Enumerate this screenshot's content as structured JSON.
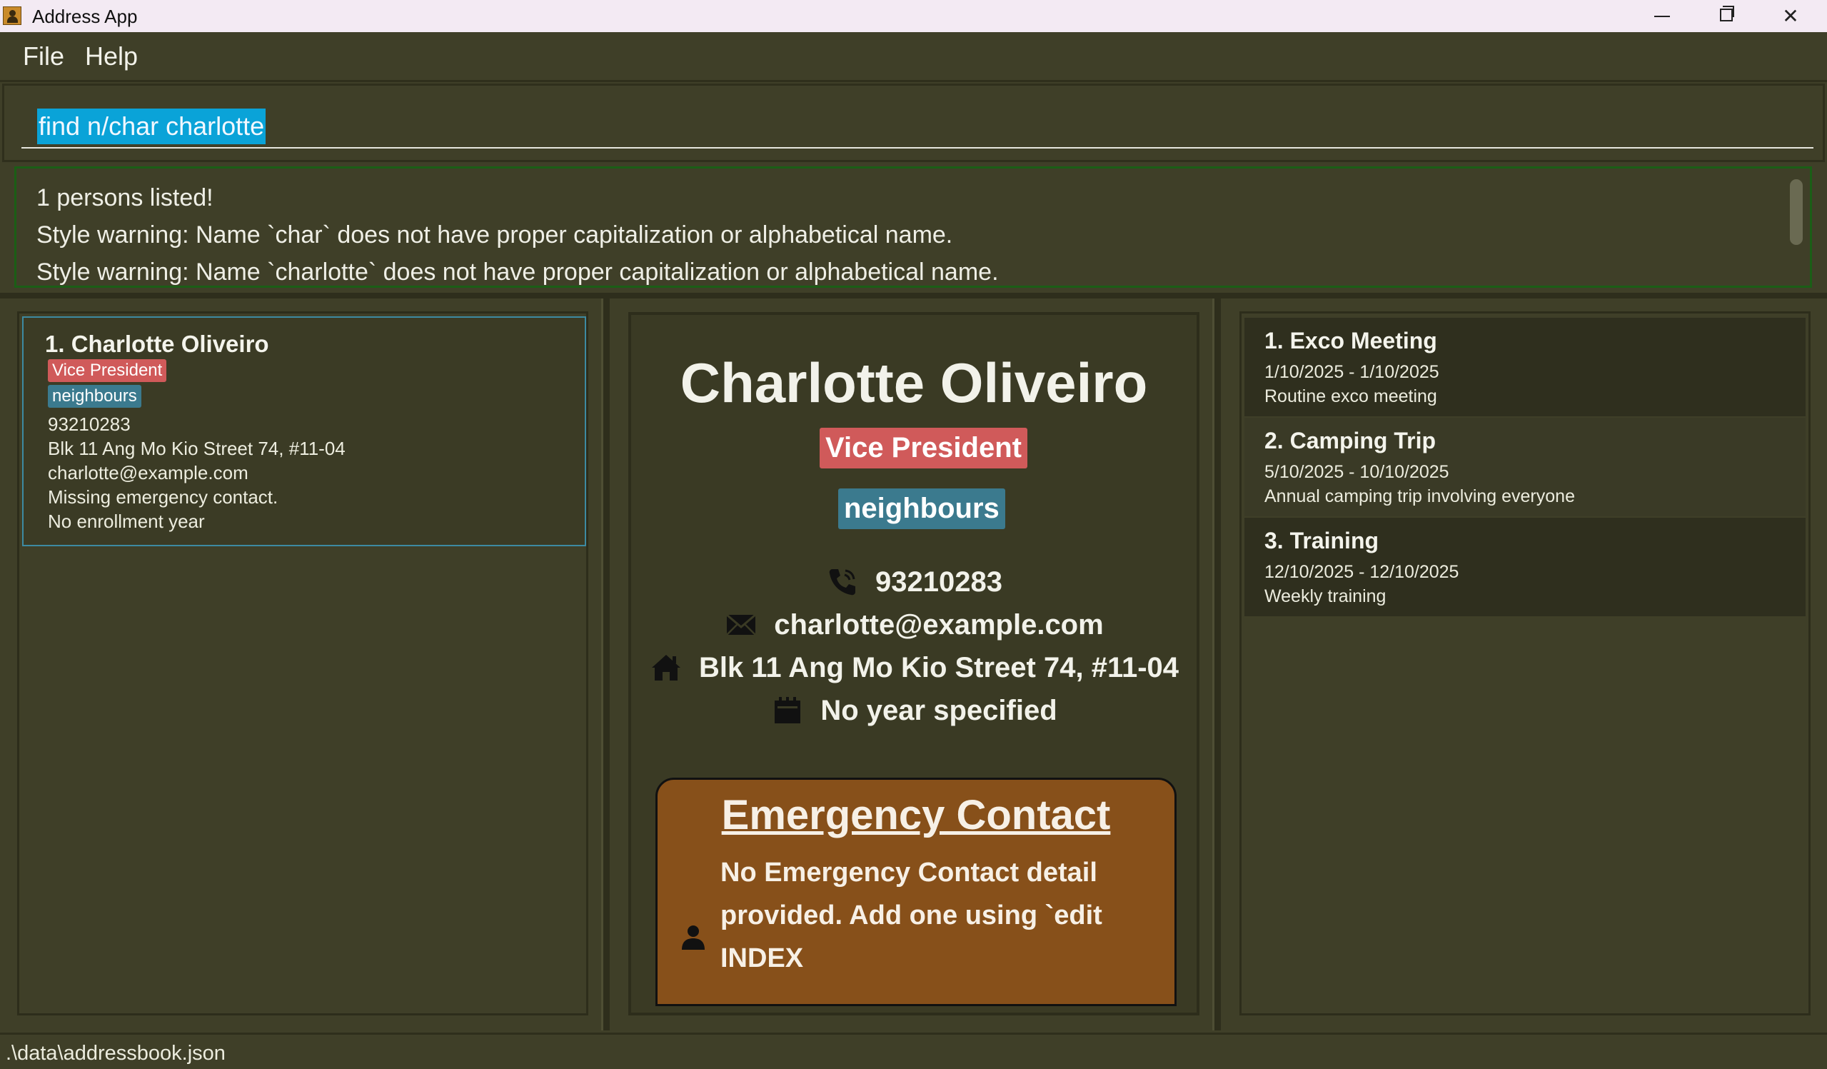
{
  "window": {
    "title": "Address App"
  },
  "menu": {
    "file": "File",
    "help": "Help"
  },
  "command": {
    "value": "find n/char charlotte"
  },
  "result": {
    "lines": [
      "1 persons listed!",
      "Style warning: Name `char` does not have proper capitalization or alphabetical name.",
      "Style warning: Name `charlotte` does not have proper capitalization or alphabetical name."
    ]
  },
  "person_list": [
    {
      "index_name": "1. Charlotte Oliveiro",
      "tags": [
        "Vice President",
        "neighbours"
      ],
      "phone": "93210283",
      "address": "Blk 11 Ang Mo Kio Street 74, #11-04",
      "email": "charlotte@example.com",
      "emergency": "Missing emergency contact.",
      "year": "No enrollment year"
    }
  ],
  "details": {
    "name": "Charlotte Oliveiro",
    "tags": [
      "Vice President",
      "neighbours"
    ],
    "phone": "93210283",
    "email": "charlotte@example.com",
    "address": "Blk 11 Ang Mo Kio Street 74, #11-04",
    "year": "No year specified",
    "emergency_title": "Emergency Contact",
    "emergency_text": "No Emergency Contact detail provided. Add one using `edit INDEX"
  },
  "events": [
    {
      "title": "1. Exco Meeting",
      "date": "1/10/2025 - 1/10/2025",
      "desc": "Routine exco meeting"
    },
    {
      "title": "2. Camping Trip",
      "date": "5/10/2025 - 10/10/2025",
      "desc": "Annual camping trip involving everyone"
    },
    {
      "title": "3. Training",
      "date": "12/10/2025 - 12/10/2025",
      "desc": "Weekly training"
    }
  ],
  "status": {
    "path": ".\\data\\addressbook.json"
  },
  "colors": {
    "background": "#3f3f28",
    "tag_vice_president": "#d05a5a",
    "tag_neighbours": "#3b7a8e",
    "emergency_card": "#87501a",
    "command_highlight": "#0aa3d8",
    "selected_border": "#3d8aa2"
  },
  "icons": [
    "app-icon",
    "minimize-icon",
    "maximize-icon",
    "close-icon",
    "phone-icon",
    "email-icon",
    "home-icon",
    "calendar-icon",
    "person-icon"
  ]
}
